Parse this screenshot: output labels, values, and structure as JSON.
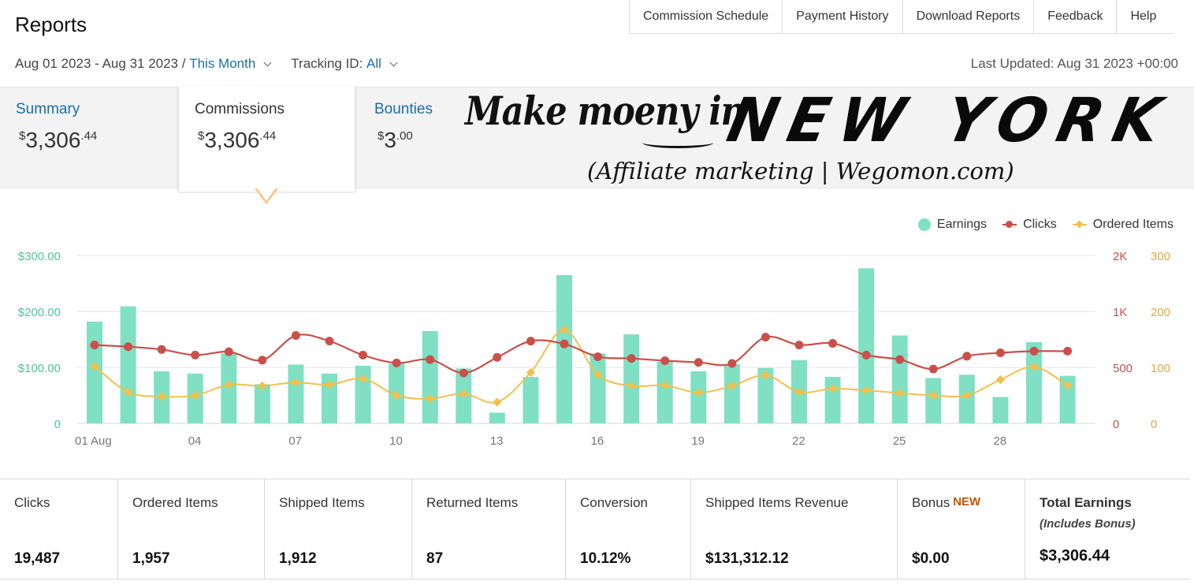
{
  "header": {
    "title": "Reports",
    "nav": [
      "Commission Schedule",
      "Payment History",
      "Download Reports",
      "Feedback",
      "Help"
    ]
  },
  "filters": {
    "date_range": "Aug 01 2023 - Aug 31 2023 /",
    "period": "This Month",
    "tracking_label": "Tracking ID:",
    "tracking_value": "All",
    "last_updated": "Last Updated: Aug 31 2023 +00:00"
  },
  "tabs": {
    "summary": {
      "label": "Summary",
      "currency": "$",
      "whole": "3,306",
      "cents": ".44"
    },
    "commissions": {
      "label": "Commissions",
      "currency": "$",
      "whole": "3,306",
      "cents": ".44"
    },
    "bounties": {
      "label": "Bounties",
      "currency": "$",
      "whole": "3",
      "cents": ".00"
    }
  },
  "promo": {
    "script": "Make moeny in",
    "bold": "NEW YORK",
    "sub": "(Affiliate marketing | Wegomon.com)"
  },
  "colors": {
    "earnings": "#7fe0c3",
    "clicks": "#c9504a",
    "ordered": "#f0c04e",
    "left_axis": "#4fc49e",
    "right_axis_clicks": "#c9504a",
    "right_axis_ordered": "#e3a83a",
    "link": "#1a6ea8"
  },
  "chart_data": {
    "type": "bar",
    "legend": [
      "Earnings",
      "Clicks",
      "Ordered Items"
    ],
    "x": [
      "01 Aug",
      "02",
      "03",
      "04",
      "05",
      "06",
      "07",
      "08",
      "09",
      "10",
      "11",
      "12",
      "13",
      "14",
      "15",
      "16",
      "17",
      "18",
      "19",
      "20",
      "21",
      "22",
      "23",
      "24",
      "25",
      "26",
      "27",
      "28",
      "29",
      "30"
    ],
    "x_tick_labels": {
      "0": "01 Aug",
      "3": "04",
      "6": "07",
      "9": "10",
      "12": "13",
      "15": "16",
      "18": "19",
      "21": "22",
      "24": "25",
      "27": "28"
    },
    "y_left_ticks": [
      "$300.00",
      "$200.00",
      "$100.00",
      "0"
    ],
    "y_left_range": [
      0,
      300
    ],
    "y_clicks_ticks": [
      "2K",
      "1K",
      "500",
      "0"
    ],
    "y_clicks_range": [
      0,
      1500
    ],
    "y_ordered_ticks": [
      "300",
      "200",
      "100",
      "0"
    ],
    "y_ordered_range": [
      0,
      300
    ],
    "series": [
      {
        "name": "Earnings",
        "type": "bar",
        "axis": "left",
        "values": [
          182,
          209,
          93,
          89,
          125,
          70,
          105,
          89,
          103,
          107,
          165,
          98,
          19,
          83,
          265,
          125,
          159,
          110,
          93,
          106,
          99,
          113,
          83,
          277,
          157,
          81,
          87,
          47,
          145,
          85
        ]
      },
      {
        "name": "Clicks",
        "type": "line",
        "axis": "clicks",
        "values": [
          700,
          685,
          660,
          610,
          640,
          565,
          785,
          735,
          610,
          540,
          570,
          450,
          590,
          735,
          710,
          595,
          580,
          560,
          545,
          535,
          770,
          700,
          715,
          610,
          570,
          485,
          600,
          630,
          645,
          645
        ]
      },
      {
        "name": "Ordered Items",
        "type": "line",
        "axis": "ordered",
        "values": [
          102,
          56,
          48,
          50,
          69,
          67,
          73,
          69,
          80,
          50,
          44,
          53,
          38,
          91,
          167,
          87,
          67,
          68,
          55,
          67,
          86,
          56,
          62,
          59,
          54,
          50,
          50,
          78,
          101,
          68
        ]
      }
    ]
  },
  "stats": [
    {
      "label": "Clicks",
      "value": "19,487"
    },
    {
      "label": "Ordered Items",
      "value": "1,957"
    },
    {
      "label": "Shipped Items",
      "value": "1,912"
    },
    {
      "label": "Returned Items",
      "value": "87"
    },
    {
      "label": "Conversion",
      "value": "10.12%"
    },
    {
      "label": "Shipped Items Revenue",
      "value": "$131,312.12"
    },
    {
      "label": "Bonus",
      "badge": "NEW",
      "value": "$0.00"
    },
    {
      "label": "Total Earnings",
      "sub": "(Includes Bonus)",
      "value": "$3,306.44"
    }
  ]
}
